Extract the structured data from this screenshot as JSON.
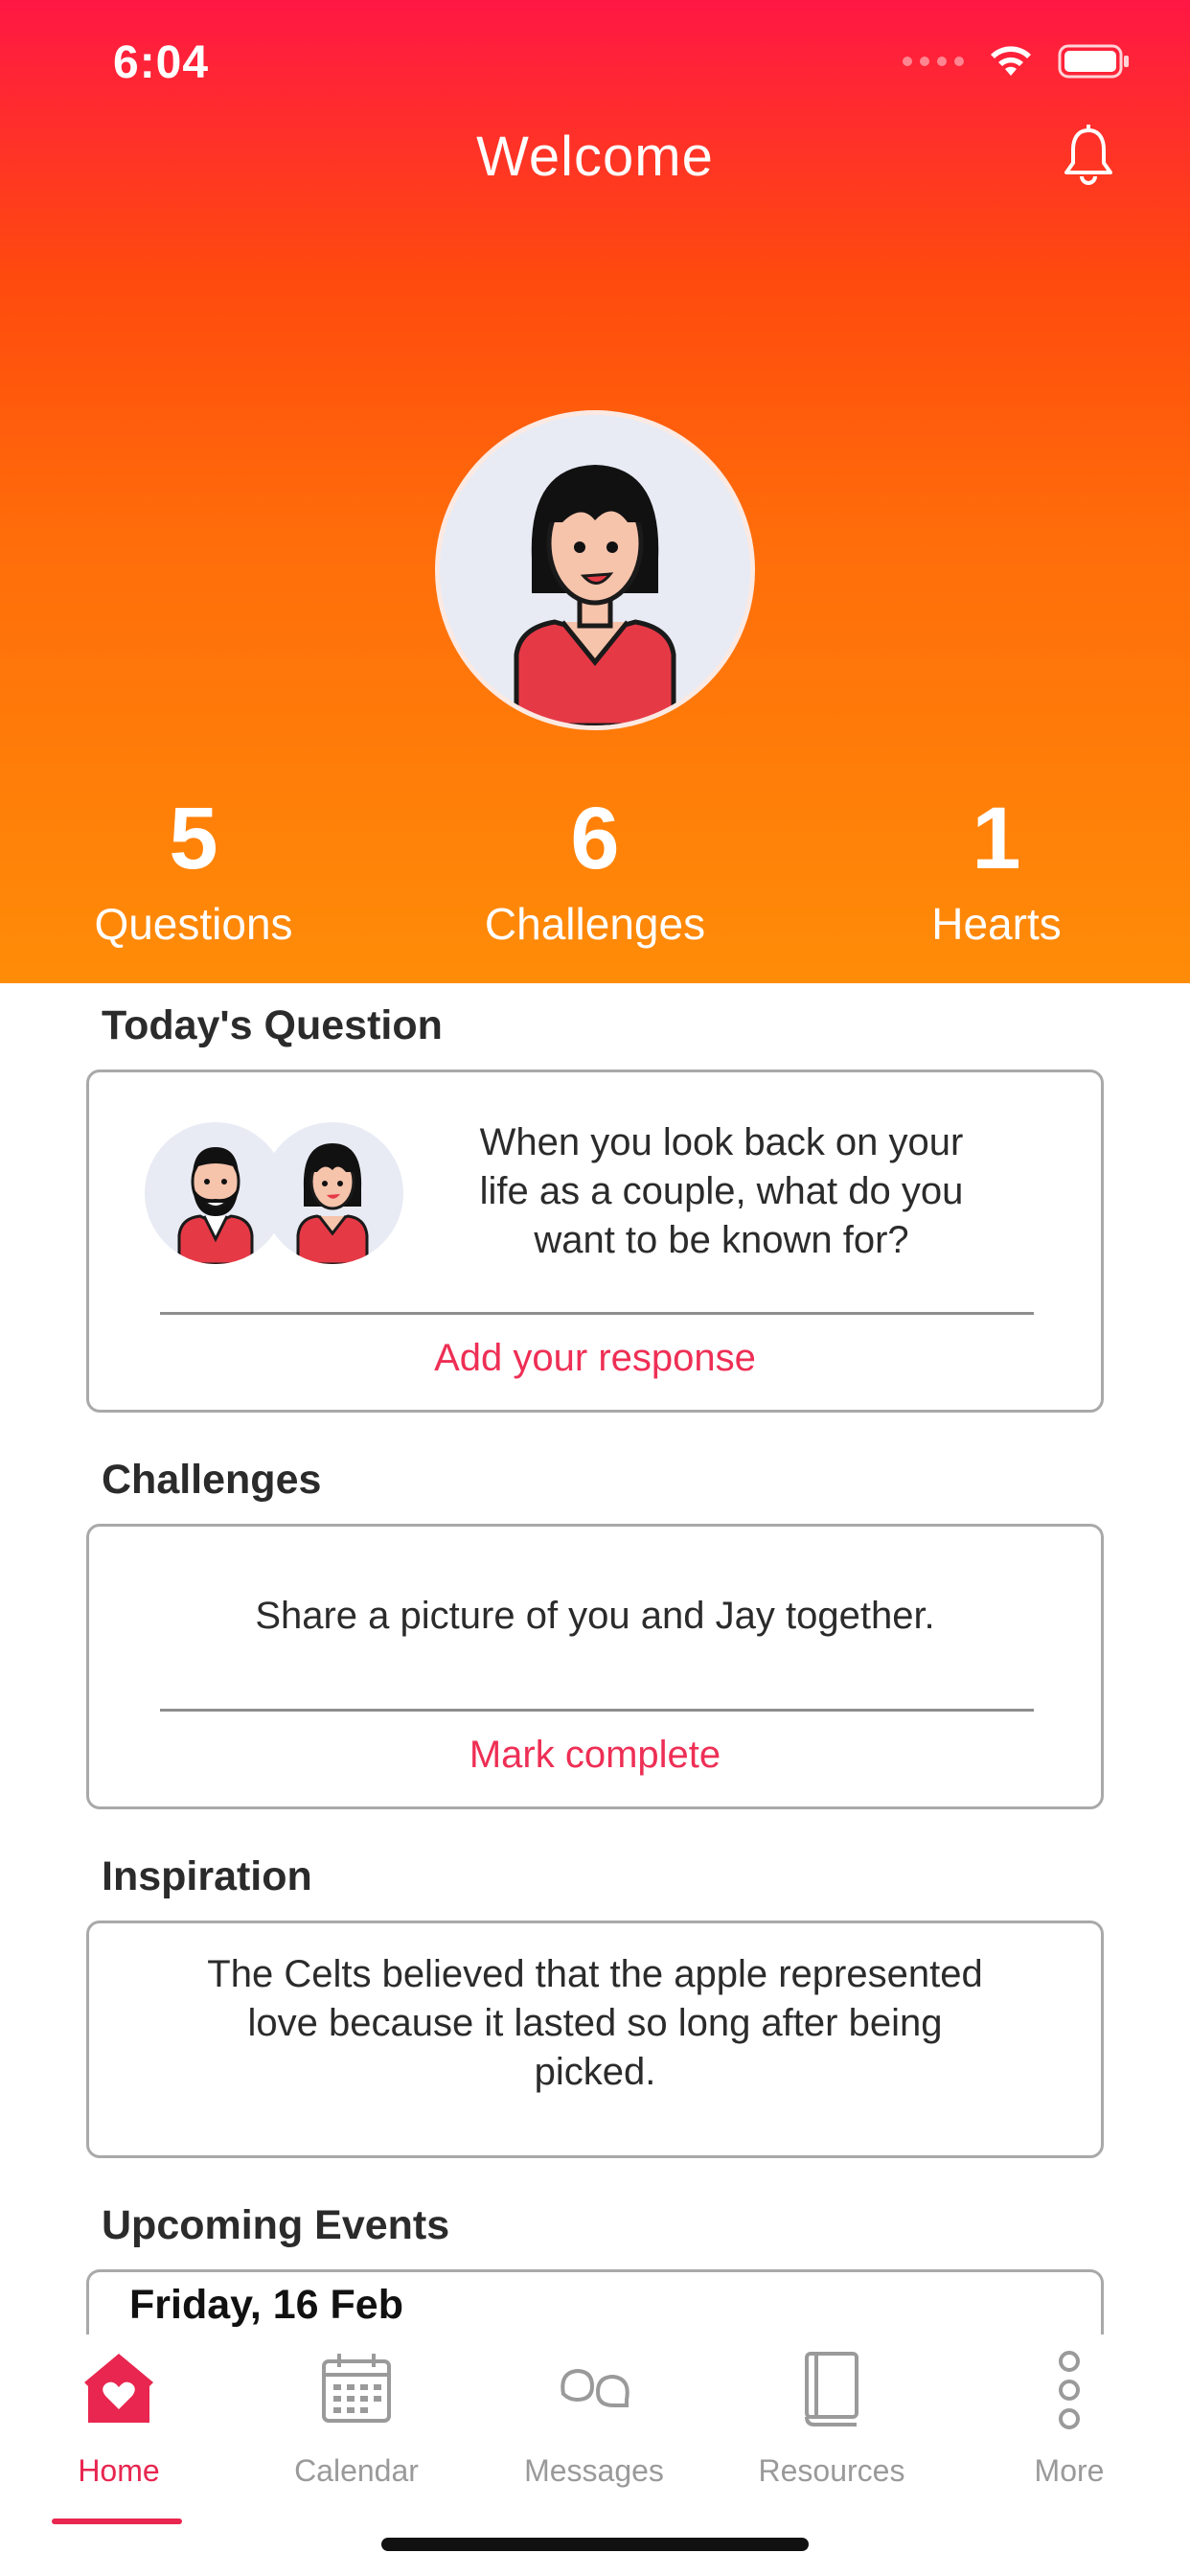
{
  "status_bar": {
    "time": "6:04"
  },
  "header": {
    "title": "Welcome"
  },
  "stats": [
    {
      "value": "5",
      "label": "Questions"
    },
    {
      "value": "6",
      "label": "Challenges"
    },
    {
      "value": "1",
      "label": "Hearts"
    }
  ],
  "todays_question": {
    "heading": "Today's Question",
    "text": "When you look back on your life as a couple, what do you want to be known for?",
    "action": "Add your response"
  },
  "challenges": {
    "heading": "Challenges",
    "text": "Share a picture of you and Jay together.",
    "action": "Mark complete"
  },
  "inspiration": {
    "heading": "Inspiration",
    "text": "The Celts believed that the apple represented love because it lasted so long after being picked."
  },
  "upcoming_events": {
    "heading": "Upcoming Events",
    "first_date": "Friday, 16 Feb"
  },
  "tabs": [
    {
      "label": "Home",
      "icon": "home-heart-icon",
      "active": true
    },
    {
      "label": "Calendar",
      "icon": "calendar-icon",
      "active": false
    },
    {
      "label": "Messages",
      "icon": "messages-icon",
      "active": false
    },
    {
      "label": "Resources",
      "icon": "book-icon",
      "active": false
    },
    {
      "label": "More",
      "icon": "more-dots-icon",
      "active": false
    }
  ],
  "colors": {
    "accent": "#e8264f",
    "gradient_top": "#ff1744",
    "gradient_bottom": "#ff8c08",
    "tab_inactive": "#9a9a9a"
  }
}
